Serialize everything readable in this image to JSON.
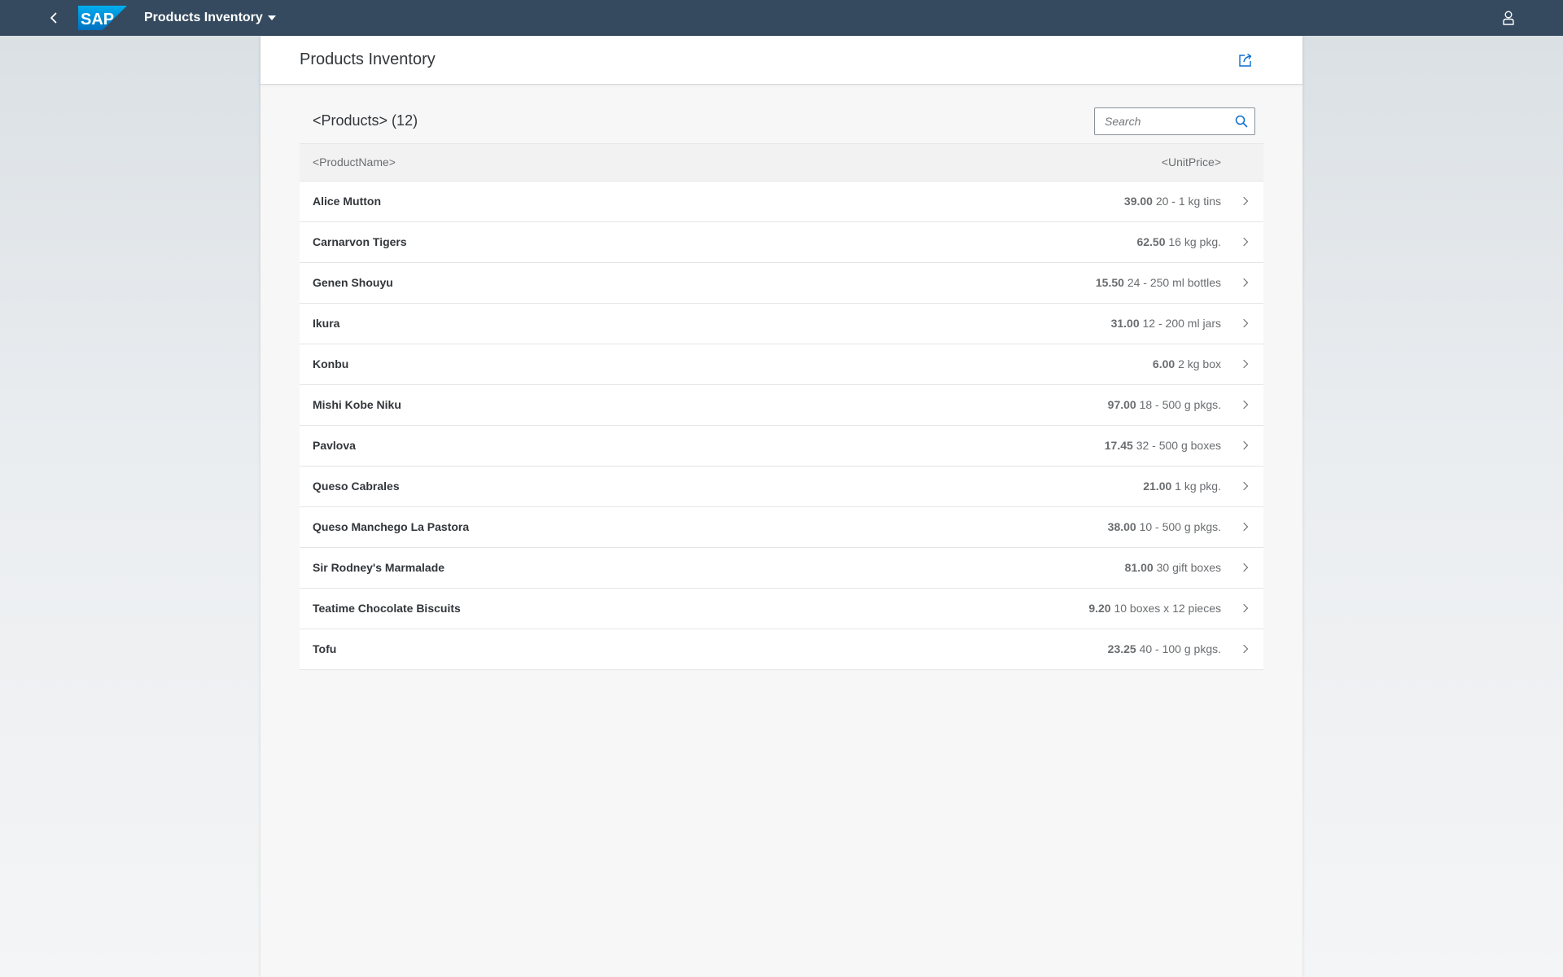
{
  "shell": {
    "logo_text": "SAP",
    "app_title": "Products Inventory",
    "icons": {
      "back": "back-chevron-icon",
      "menu": "caret-down-icon",
      "user": "user-icon"
    },
    "background_color": "#354a5f",
    "logo_color": "#0a6ed1"
  },
  "page": {
    "title": "Products Inventory",
    "share_icon": "share-icon"
  },
  "table": {
    "title": "<Products> (12)",
    "search_placeholder": "Search",
    "search_value": "",
    "columns": [
      "<ProductName>",
      "<UnitPrice>"
    ],
    "rows": [
      {
        "name": "Alice Mutton",
        "price": "39.00",
        "unit": "20 - 1 kg tins"
      },
      {
        "name": "Carnarvon Tigers",
        "price": "62.50",
        "unit": "16 kg pkg."
      },
      {
        "name": "Genen Shouyu",
        "price": "15.50",
        "unit": "24 - 250 ml bottles"
      },
      {
        "name": "Ikura",
        "price": "31.00",
        "unit": "12 - 200 ml jars"
      },
      {
        "name": "Konbu",
        "price": "6.00",
        "unit": "2 kg box"
      },
      {
        "name": "Mishi Kobe Niku",
        "price": "97.00",
        "unit": "18 - 500 g pkgs."
      },
      {
        "name": "Pavlova",
        "price": "17.45",
        "unit": "32 - 500 g boxes"
      },
      {
        "name": "Queso Cabrales",
        "price": "21.00",
        "unit": "1 kg pkg."
      },
      {
        "name": "Queso Manchego La Pastora",
        "price": "38.00",
        "unit": "10 - 500 g pkgs."
      },
      {
        "name": "Sir Rodney's Marmalade",
        "price": "81.00",
        "unit": "30 gift boxes"
      },
      {
        "name": "Teatime Chocolate Biscuits",
        "price": "9.20",
        "unit": "10 boxes x 12 pieces"
      },
      {
        "name": "Tofu",
        "price": "23.25",
        "unit": "40 - 100 g pkgs."
      }
    ]
  }
}
